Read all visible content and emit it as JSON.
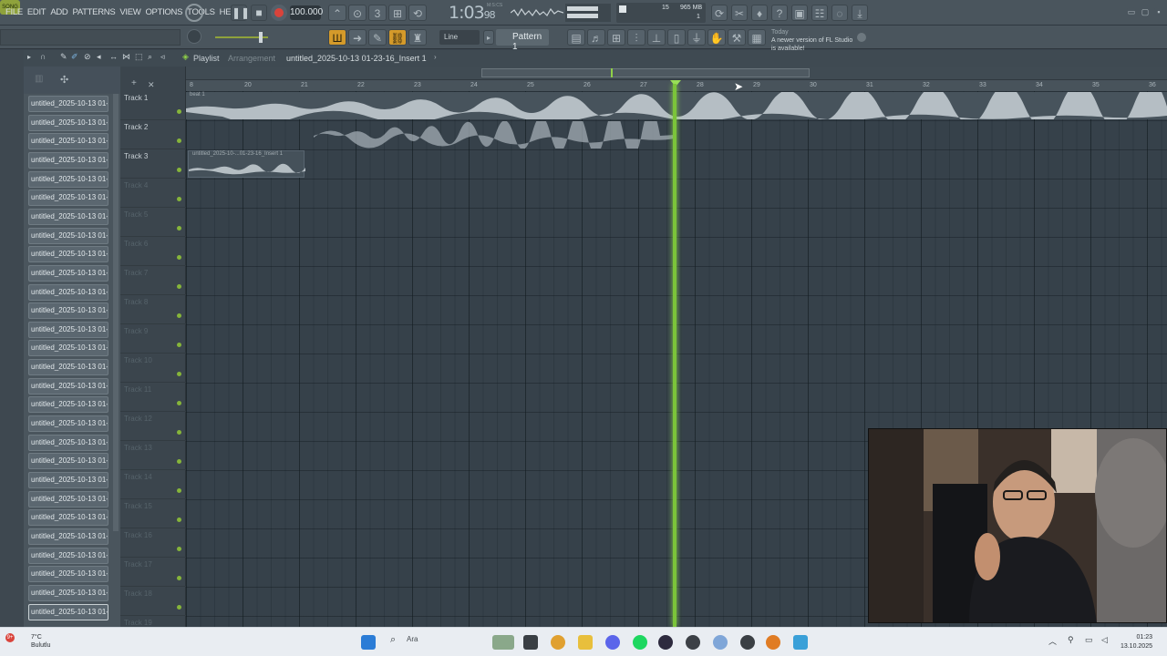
{
  "menu": [
    "FILE",
    "EDIT",
    "ADD",
    "PATTERNS",
    "VIEW",
    "OPTIONS",
    "TOOLS",
    "HELP"
  ],
  "transport": {
    "mode": "SONG",
    "tempo": "100.000",
    "time_main": "1:03",
    "time_sub": "98",
    "time_unit": "M:S:CS",
    "cpu_voices": "15",
    "mem": "965 MB",
    "cpu_line2": "1"
  },
  "toolbar": {
    "snap": "Line",
    "pattern": "Pattern 1",
    "news_today": "Today",
    "news_text": "A newer version of FL Studio is available!"
  },
  "playlist": {
    "title": "Playlist",
    "subtitle": "Arrangement",
    "breadcrumb": "untitled_2025-10-13 01-23-16_Insert 1",
    "ruler_ticks": [
      "8",
      "20",
      "21",
      "22",
      "23",
      "24",
      "25",
      "26",
      "27",
      "28",
      "29",
      "30",
      "31",
      "32",
      "33",
      "34",
      "35",
      "36"
    ],
    "tracks": [
      "Track 1",
      "Track 2",
      "Track 3",
      "Track 4",
      "Track 5",
      "Track 6",
      "Track 7",
      "Track 8",
      "Track 9",
      "Track 10",
      "Track 11",
      "Track 12",
      "Track 13",
      "Track 14",
      "Track 15",
      "Track 16",
      "Track 17",
      "Track 18",
      "Track 19"
    ],
    "clips": {
      "beat": "beat 1",
      "insert": "untitled_2025-10-...01-23-16_Insert 1"
    }
  },
  "browser": {
    "item_label": "untitled_2025-10-13 01-...",
    "count": 28
  },
  "taskbar": {
    "temp": "7°C",
    "weather": "Bulutlu",
    "badge": "9+",
    "search": "Ara",
    "time": "01:23",
    "date": "13.10.2025"
  },
  "colors": {
    "playhead": "#7bc43a",
    "bg": "#36414a",
    "record": "#d9433b"
  }
}
